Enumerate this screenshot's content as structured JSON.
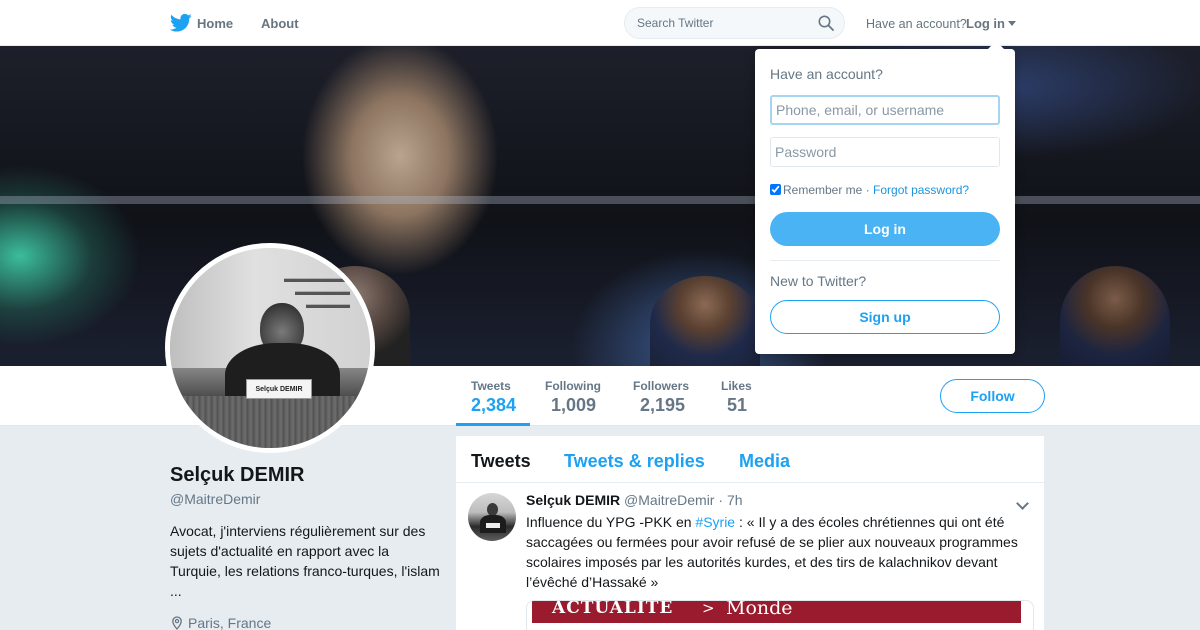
{
  "nav": {
    "home_label": "Home",
    "about_label": "About",
    "search_placeholder": "Search Twitter",
    "have_account_text": "Have an account?",
    "login_label": "Log in",
    "brand_color": "#1da1f2"
  },
  "profile": {
    "name": "Selçuk DEMIR",
    "handle": "@MaitreDemir",
    "bio": "Avocat, j'interviens régulièrement sur des sujets d'actualité en rapport avec la Turquie, les relations franco-turques, l'islam ...",
    "location": "Paris, France",
    "avatar_nameplate": "Selçuk DEMIR",
    "follow_label": "Follow"
  },
  "stats": [
    {
      "label": "Tweets",
      "value": "2,384",
      "active": true
    },
    {
      "label": "Following",
      "value": "1,009",
      "active": false
    },
    {
      "label": "Followers",
      "value": "2,195",
      "active": false
    },
    {
      "label": "Likes",
      "value": "51",
      "active": false
    }
  ],
  "timeline": {
    "tabs": [
      "Tweets",
      "Tweets & replies",
      "Media"
    ],
    "active_tab": "Tweets"
  },
  "tweet": {
    "author_name": "Selçuk DEMIR",
    "author_handle": "@MaitreDemir",
    "separator": "·",
    "time": "7h",
    "text_before": "Influence du YPG -PKK en ",
    "hashtag": "#Syrie",
    "text_after": " : « Il y a des écoles chrétiennes qui ont été saccagées ou fermées pour avoir refusé de se plier aux nouveaux programmes scolaires imposés par les autorités kurdes, et des tirs de kalachnikov devant l’évêché d’Hassaké »",
    "card_kicker": "ACTUALITE",
    "card_separator": ">",
    "card_section": "Monde"
  },
  "login_dropdown": {
    "title": "Have an account?",
    "username_placeholder": "Phone, email, or username",
    "password_placeholder": "Password",
    "remember_label": "Remember me",
    "remember_checked": true,
    "separator": "·",
    "forgot_label": "Forgot password?",
    "login_button": "Log in",
    "new_text": "New to Twitter?",
    "signup_button": "Sign up"
  }
}
